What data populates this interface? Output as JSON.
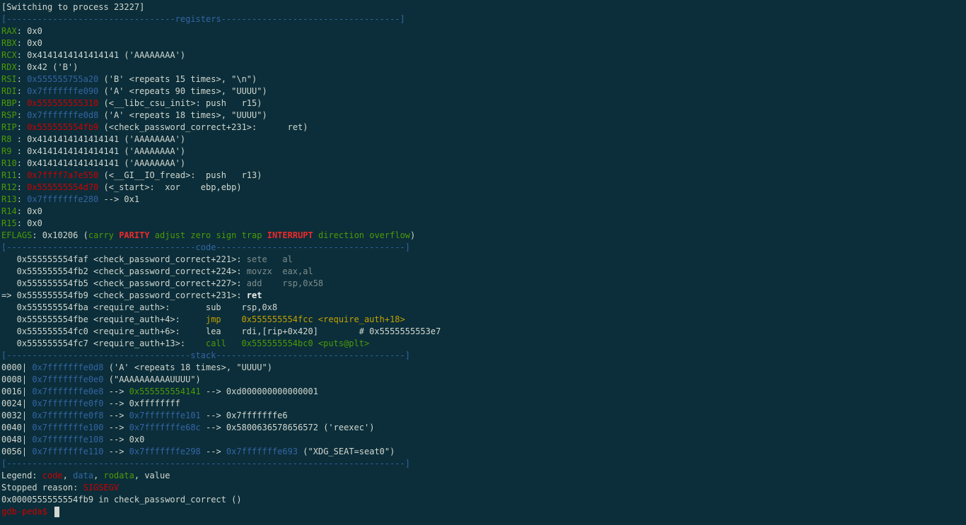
{
  "colors": {
    "background": "#0b2e3a",
    "default": "#d3d7cf",
    "green": "#4e9a06",
    "blue": "#3465a4",
    "red": "#cc0000",
    "red_bold": "#ef2929",
    "yellow": "#c4a000",
    "gray": "#7f8c8d"
  },
  "lines": [
    {
      "name": "switch-message",
      "segs": [
        {
          "t": "[Switching to process 23227]",
          "c": "w"
        }
      ]
    },
    {
      "name": "registers-header",
      "segs": [
        {
          "t": "[---------------------------------",
          "c": "b"
        },
        {
          "t": "registers",
          "c": "b"
        },
        {
          "t": "-----------------------------------]",
          "c": "b"
        }
      ]
    },
    {
      "name": "register-rax",
      "segs": [
        {
          "t": "RAX",
          "c": "g"
        },
        {
          "t": ": 0x0",
          "c": "w"
        }
      ]
    },
    {
      "name": "register-rbx",
      "segs": [
        {
          "t": "RBX",
          "c": "g"
        },
        {
          "t": ": 0x0",
          "c": "w"
        }
      ]
    },
    {
      "name": "register-rcx",
      "segs": [
        {
          "t": "RCX",
          "c": "g"
        },
        {
          "t": ": 0x4141414141414141 ('AAAAAAAA')",
          "c": "w"
        }
      ]
    },
    {
      "name": "register-rdx",
      "segs": [
        {
          "t": "RDX",
          "c": "g"
        },
        {
          "t": ": 0x42 ('B')",
          "c": "w"
        }
      ]
    },
    {
      "name": "register-rsi",
      "segs": [
        {
          "t": "RSI",
          "c": "g"
        },
        {
          "t": ": ",
          "c": "w"
        },
        {
          "t": "0x555555755a20",
          "c": "b"
        },
        {
          "t": " ('B' <repeats 15 times>, \"\\n\")",
          "c": "w"
        }
      ]
    },
    {
      "name": "register-rdi",
      "segs": [
        {
          "t": "RDI",
          "c": "g"
        },
        {
          "t": ": ",
          "c": "w"
        },
        {
          "t": "0x7fffffffe090",
          "c": "b"
        },
        {
          "t": " ('A' <repeats 90 times>, \"UUUU\")",
          "c": "w"
        }
      ]
    },
    {
      "name": "register-rbp",
      "segs": [
        {
          "t": "RBP",
          "c": "g"
        },
        {
          "t": ": ",
          "c": "w"
        },
        {
          "t": "0x555555555310",
          "c": "r"
        },
        {
          "t": " (<__libc_csu_init>: push   r15)",
          "c": "w"
        }
      ]
    },
    {
      "name": "register-rsp",
      "segs": [
        {
          "t": "RSP",
          "c": "g"
        },
        {
          "t": ": ",
          "c": "w"
        },
        {
          "t": "0x7fffffffe0d8",
          "c": "b"
        },
        {
          "t": " ('A' <repeats 18 times>, \"UUUU\")",
          "c": "w"
        }
      ]
    },
    {
      "name": "register-rip",
      "segs": [
        {
          "t": "RIP",
          "c": "g"
        },
        {
          "t": ": ",
          "c": "w"
        },
        {
          "t": "0x555555554fb9",
          "c": "r"
        },
        {
          "t": " (<check_password_correct+231>:      ret)",
          "c": "w"
        }
      ]
    },
    {
      "name": "register-r8",
      "segs": [
        {
          "t": "R8 ",
          "c": "g"
        },
        {
          "t": ": 0x4141414141414141 ('AAAAAAAA')",
          "c": "w"
        }
      ]
    },
    {
      "name": "register-r9",
      "segs": [
        {
          "t": "R9 ",
          "c": "g"
        },
        {
          "t": ": 0x4141414141414141 ('AAAAAAAA')",
          "c": "w"
        }
      ]
    },
    {
      "name": "register-r10",
      "segs": [
        {
          "t": "R10",
          "c": "g"
        },
        {
          "t": ": 0x4141414141414141 ('AAAAAAAA')",
          "c": "w"
        }
      ]
    },
    {
      "name": "register-r11",
      "segs": [
        {
          "t": "R11",
          "c": "g"
        },
        {
          "t": ": ",
          "c": "w"
        },
        {
          "t": "0x7ffff7a7e550",
          "c": "r"
        },
        {
          "t": " (<__GI__IO_fread>:  push   r13)",
          "c": "w"
        }
      ]
    },
    {
      "name": "register-r12",
      "segs": [
        {
          "t": "R12",
          "c": "g"
        },
        {
          "t": ": ",
          "c": "w"
        },
        {
          "t": "0x555555554d70",
          "c": "r"
        },
        {
          "t": " (<_start>:  xor    ebp,ebp)",
          "c": "w"
        }
      ]
    },
    {
      "name": "register-r13",
      "segs": [
        {
          "t": "R13",
          "c": "g"
        },
        {
          "t": ": ",
          "c": "w"
        },
        {
          "t": "0x7fffffffe280",
          "c": "b"
        },
        {
          "t": " --> 0x1",
          "c": "w"
        }
      ]
    },
    {
      "name": "register-r14",
      "segs": [
        {
          "t": "R14",
          "c": "g"
        },
        {
          "t": ": 0x0",
          "c": "w"
        }
      ]
    },
    {
      "name": "register-r15",
      "segs": [
        {
          "t": "R15",
          "c": "g"
        },
        {
          "t": ": 0x0",
          "c": "w"
        }
      ]
    },
    {
      "name": "eflags-line",
      "segs": [
        {
          "t": "EFLAGS",
          "c": "g"
        },
        {
          "t": ": 0x10206 (",
          "c": "w"
        },
        {
          "t": "carry ",
          "c": "g"
        },
        {
          "t": "PARITY",
          "c": "rb"
        },
        {
          "t": " adjust zero sign trap ",
          "c": "g"
        },
        {
          "t": "INTERRUPT",
          "c": "rb"
        },
        {
          "t": " direction overflow",
          "c": "g"
        },
        {
          "t": ")",
          "c": "w"
        }
      ]
    },
    {
      "name": "code-header",
      "segs": [
        {
          "t": "[-------------------------------------",
          "c": "b"
        },
        {
          "t": "code",
          "c": "b"
        },
        {
          "t": "-------------------------------------]",
          "c": "b"
        }
      ]
    },
    {
      "name": "code-line",
      "segs": [
        {
          "t": "   0x555555554faf <check_password_correct+221>: ",
          "c": "w"
        },
        {
          "t": "sete   al",
          "c": "gr"
        }
      ]
    },
    {
      "name": "code-line",
      "segs": [
        {
          "t": "   0x555555554fb2 <check_password_correct+224>: ",
          "c": "w"
        },
        {
          "t": "movzx  eax,al",
          "c": "gr"
        }
      ]
    },
    {
      "name": "code-line",
      "segs": [
        {
          "t": "   0x555555554fb5 <check_password_correct+227>: ",
          "c": "w"
        },
        {
          "t": "add    rsp,0x58",
          "c": "gr"
        }
      ]
    },
    {
      "name": "code-line-current",
      "segs": [
        {
          "t": "=> 0x555555554fb9 <check_password_correct+231>: ",
          "c": "w"
        },
        {
          "t": "ret",
          "c": "wb"
        }
      ]
    },
    {
      "name": "code-line",
      "segs": [
        {
          "t": "   0x555555554fba <require_auth>:       sub    rsp,0x8",
          "c": "w"
        }
      ]
    },
    {
      "name": "code-line",
      "segs": [
        {
          "t": "   0x555555554fbe <require_auth+4>:     ",
          "c": "w"
        },
        {
          "t": "jmp    0x555555554fcc <require_auth+18>",
          "c": "y"
        }
      ]
    },
    {
      "name": "code-line",
      "segs": [
        {
          "t": "   0x555555554fc0 <require_auth+6>:     lea    rdi,[rip+0x420]        # 0x5555555553e7",
          "c": "w"
        }
      ]
    },
    {
      "name": "code-line",
      "segs": [
        {
          "t": "   0x555555554fc7 <require_auth+13>:    ",
          "c": "w"
        },
        {
          "t": "call   0x555555554bc0 <puts@plt>",
          "c": "g"
        }
      ]
    },
    {
      "name": "stack-header",
      "segs": [
        {
          "t": "[------------------------------------",
          "c": "b"
        },
        {
          "t": "stack",
          "c": "b"
        },
        {
          "t": "-------------------------------------]",
          "c": "b"
        }
      ]
    },
    {
      "name": "stack-row",
      "segs": [
        {
          "t": "0000| ",
          "c": "w"
        },
        {
          "t": "0x7fffffffe0d8",
          "c": "b"
        },
        {
          "t": " ('A' <repeats 18 times>, \"UUUU\")",
          "c": "w"
        }
      ]
    },
    {
      "name": "stack-row",
      "segs": [
        {
          "t": "0008| ",
          "c": "w"
        },
        {
          "t": "0x7fffffffe0e0",
          "c": "b"
        },
        {
          "t": " (\"AAAAAAAAAAUUUU\")",
          "c": "w"
        }
      ]
    },
    {
      "name": "stack-row",
      "segs": [
        {
          "t": "0016| ",
          "c": "w"
        },
        {
          "t": "0x7fffffffe0e8",
          "c": "b"
        },
        {
          "t": " --> ",
          "c": "w"
        },
        {
          "t": "0x555555554141",
          "c": "g"
        },
        {
          "t": " --> 0xd000000000000001",
          "c": "w"
        }
      ]
    },
    {
      "name": "stack-row",
      "segs": [
        {
          "t": "0024| ",
          "c": "w"
        },
        {
          "t": "0x7fffffffe0f0",
          "c": "b"
        },
        {
          "t": " --> 0xffffffff",
          "c": "w"
        }
      ]
    },
    {
      "name": "stack-row",
      "segs": [
        {
          "t": "0032| ",
          "c": "w"
        },
        {
          "t": "0x7fffffffe0f8",
          "c": "b"
        },
        {
          "t": " --> ",
          "c": "w"
        },
        {
          "t": "0x7fffffffe101",
          "c": "b"
        },
        {
          "t": " --> 0x7fffffffe6",
          "c": "w"
        }
      ]
    },
    {
      "name": "stack-row",
      "segs": [
        {
          "t": "0040| ",
          "c": "w"
        },
        {
          "t": "0x7fffffffe100",
          "c": "b"
        },
        {
          "t": " --> ",
          "c": "w"
        },
        {
          "t": "0x7fffffffe68c",
          "c": "b"
        },
        {
          "t": " --> 0x5800636578656572 ('reexec')",
          "c": "w"
        }
      ]
    },
    {
      "name": "stack-row",
      "segs": [
        {
          "t": "0048| ",
          "c": "w"
        },
        {
          "t": "0x7fffffffe108",
          "c": "b"
        },
        {
          "t": " --> 0x0",
          "c": "w"
        }
      ]
    },
    {
      "name": "stack-row",
      "segs": [
        {
          "t": "0056| ",
          "c": "w"
        },
        {
          "t": "0x7fffffffe110",
          "c": "b"
        },
        {
          "t": " --> ",
          "c": "w"
        },
        {
          "t": "0x7fffffffe298",
          "c": "b"
        },
        {
          "t": " --> ",
          "c": "w"
        },
        {
          "t": "0x7fffffffe693",
          "c": "b"
        },
        {
          "t": " (\"XDG_SEAT=seat0\")",
          "c": "w"
        }
      ]
    },
    {
      "name": "footer-separator",
      "segs": [
        {
          "t": "[------------------------------------------------------------------------------]",
          "c": "b"
        }
      ]
    },
    {
      "name": "legend-line",
      "segs": [
        {
          "t": "Legend: ",
          "c": "w"
        },
        {
          "t": "code",
          "c": "r"
        },
        {
          "t": ", ",
          "c": "w"
        },
        {
          "t": "data",
          "c": "b"
        },
        {
          "t": ", ",
          "c": "w"
        },
        {
          "t": "rodata",
          "c": "g"
        },
        {
          "t": ", value",
          "c": "w"
        }
      ]
    },
    {
      "name": "stopped-reason",
      "segs": [
        {
          "t": "Stopped reason: ",
          "c": "w"
        },
        {
          "t": "SIGSEGV",
          "c": "r"
        }
      ]
    },
    {
      "name": "fault-location",
      "segs": [
        {
          "t": "0x0000555555554fb9 in check_password_correct ()",
          "c": "w"
        }
      ]
    }
  ],
  "prompt": {
    "text": "gdb-peda$ ",
    "color": "red"
  }
}
